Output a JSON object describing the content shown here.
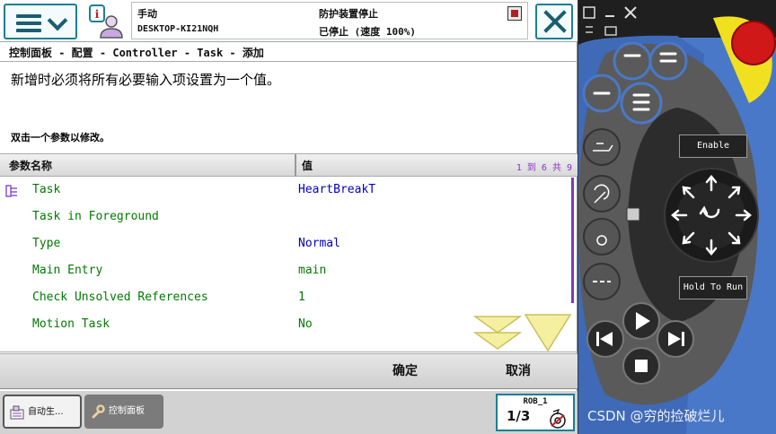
{
  "status": {
    "mode": "手动",
    "host": "DESKTOP-KI21NQH",
    "guard": "防护装置停止",
    "stop_state": "已停止 (速度 100%)"
  },
  "breadcrumb": "控制面板 - 配置 - Controller - Task - 添加",
  "instruction": "新增时必须将所有必要输入项设置为一个值。",
  "hint": "双击一个参数以修改。",
  "table": {
    "col_name": "参数名称",
    "col_value": "值",
    "count": "1 到 6 共 9",
    "rows": [
      {
        "name": "Task",
        "value": "HeartBreakT"
      },
      {
        "name": "Task in Foreground",
        "value": ""
      },
      {
        "name": "Type",
        "value": "Normal"
      },
      {
        "name": "Main Entry",
        "value": "main"
      },
      {
        "name": "Check Unsolved References",
        "value": "1"
      },
      {
        "name": "Motion Task",
        "value": "No"
      }
    ]
  },
  "actions": {
    "ok": "确定",
    "cancel": "取消"
  },
  "taskbar": {
    "auto": "自动生...",
    "panel": "控制面板",
    "rob": "ROB_1",
    "fraction": "1/3"
  },
  "pendant": {
    "enable": "Enable",
    "hold": "Hold To Run"
  },
  "watermark": "CSDN @穷的捡破烂儿",
  "colors": {
    "accent": "#1a7f94",
    "row_name": "#007a00",
    "row_value": "#0000c8",
    "count": "#8a30c8",
    "pendant_blue": "#4a78c8",
    "stop_red": "#d01818",
    "stop_yellow": "#f0e020"
  }
}
